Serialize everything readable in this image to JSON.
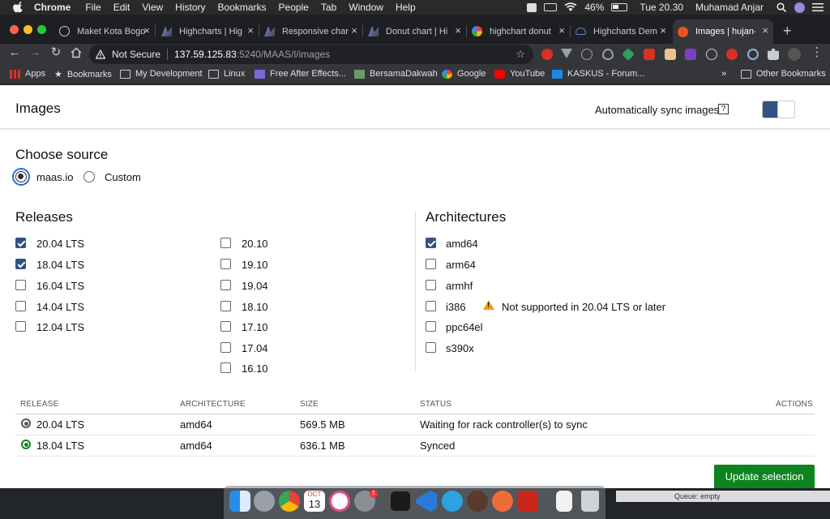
{
  "menubar": {
    "app_name": "Chrome",
    "items": [
      "File",
      "Edit",
      "View",
      "History",
      "Bookmarks",
      "People",
      "Tab",
      "Window",
      "Help"
    ],
    "battery": "46%",
    "clock": "Tue 20.30",
    "user": "Muhamad Anjar"
  },
  "tabs": [
    {
      "label": "Maket Kota Bogo"
    },
    {
      "label": "Highcharts | Hig"
    },
    {
      "label": "Responsive char"
    },
    {
      "label": "Donut chart | Hi"
    },
    {
      "label": "highchart donut"
    },
    {
      "label": "Highcharts Dem"
    },
    {
      "label": "Images | hujan-i"
    }
  ],
  "toolbar": {
    "security_label": "Not Secure",
    "url_host": "137.59.125.83",
    "url_path": ":5240/MAAS/l/images"
  },
  "bookmarks": {
    "items": [
      "Apps",
      "Bookmarks",
      "My Development",
      "Linux",
      "Free After Effects...",
      "BersamaDakwah",
      "Google",
      "YouTube",
      "KASKUS - Forum..."
    ],
    "overflow": "»",
    "other": "Other Bookmarks"
  },
  "page": {
    "title": "Images",
    "auto_sync_label": "Automatically sync images",
    "help_glyph": "?",
    "auto_sync_on": true,
    "choose_source": {
      "heading": "Choose source",
      "options": [
        {
          "label": "maas.io",
          "selected": true
        },
        {
          "label": "Custom",
          "selected": false
        }
      ]
    },
    "releases": {
      "heading": "Releases",
      "col1": [
        {
          "label": "20.04 LTS",
          "checked": true
        },
        {
          "label": "18.04 LTS",
          "checked": true
        },
        {
          "label": "16.04 LTS",
          "checked": false
        },
        {
          "label": "14.04 LTS",
          "checked": false
        },
        {
          "label": "12.04 LTS",
          "checked": false
        }
      ],
      "col2": [
        {
          "label": "20.10",
          "checked": false
        },
        {
          "label": "19.10",
          "checked": false
        },
        {
          "label": "19.04",
          "checked": false
        },
        {
          "label": "18.10",
          "checked": false
        },
        {
          "label": "17.10",
          "checked": false
        },
        {
          "label": "17.04",
          "checked": false
        },
        {
          "label": "16.10",
          "checked": false
        }
      ]
    },
    "architectures": {
      "heading": "Architectures",
      "items": [
        {
          "label": "amd64",
          "checked": true
        },
        {
          "label": "arm64",
          "checked": false
        },
        {
          "label": "armhf",
          "checked": false
        },
        {
          "label": "i386",
          "checked": false,
          "warning": "Not supported in 20.04 LTS or later"
        },
        {
          "label": "ppc64el",
          "checked": false
        },
        {
          "label": "s390x",
          "checked": false
        }
      ]
    },
    "table": {
      "headers": {
        "release": "RELEASE",
        "architecture": "ARCHITECTURE",
        "size": "SIZE",
        "status": "STATUS",
        "actions": "ACTIONS"
      },
      "rows": [
        {
          "release": "20.04 LTS",
          "architecture": "amd64",
          "size": "569.5 MB",
          "status": "Waiting for rack controller(s) to sync",
          "state": "pending"
        },
        {
          "release": "18.04 LTS",
          "architecture": "amd64",
          "size": "636.1 MB",
          "status": "Synced",
          "state": "synced"
        }
      ]
    },
    "update_button": "Update selection"
  },
  "dock": {
    "queue_text": "Queue: empty",
    "calendar_month": "OCT",
    "calendar_day": "13",
    "badge": "1"
  },
  "colors": {
    "accent_blue": "#335280",
    "success_green": "#0e8420",
    "warning_orange": "#f0a014"
  }
}
